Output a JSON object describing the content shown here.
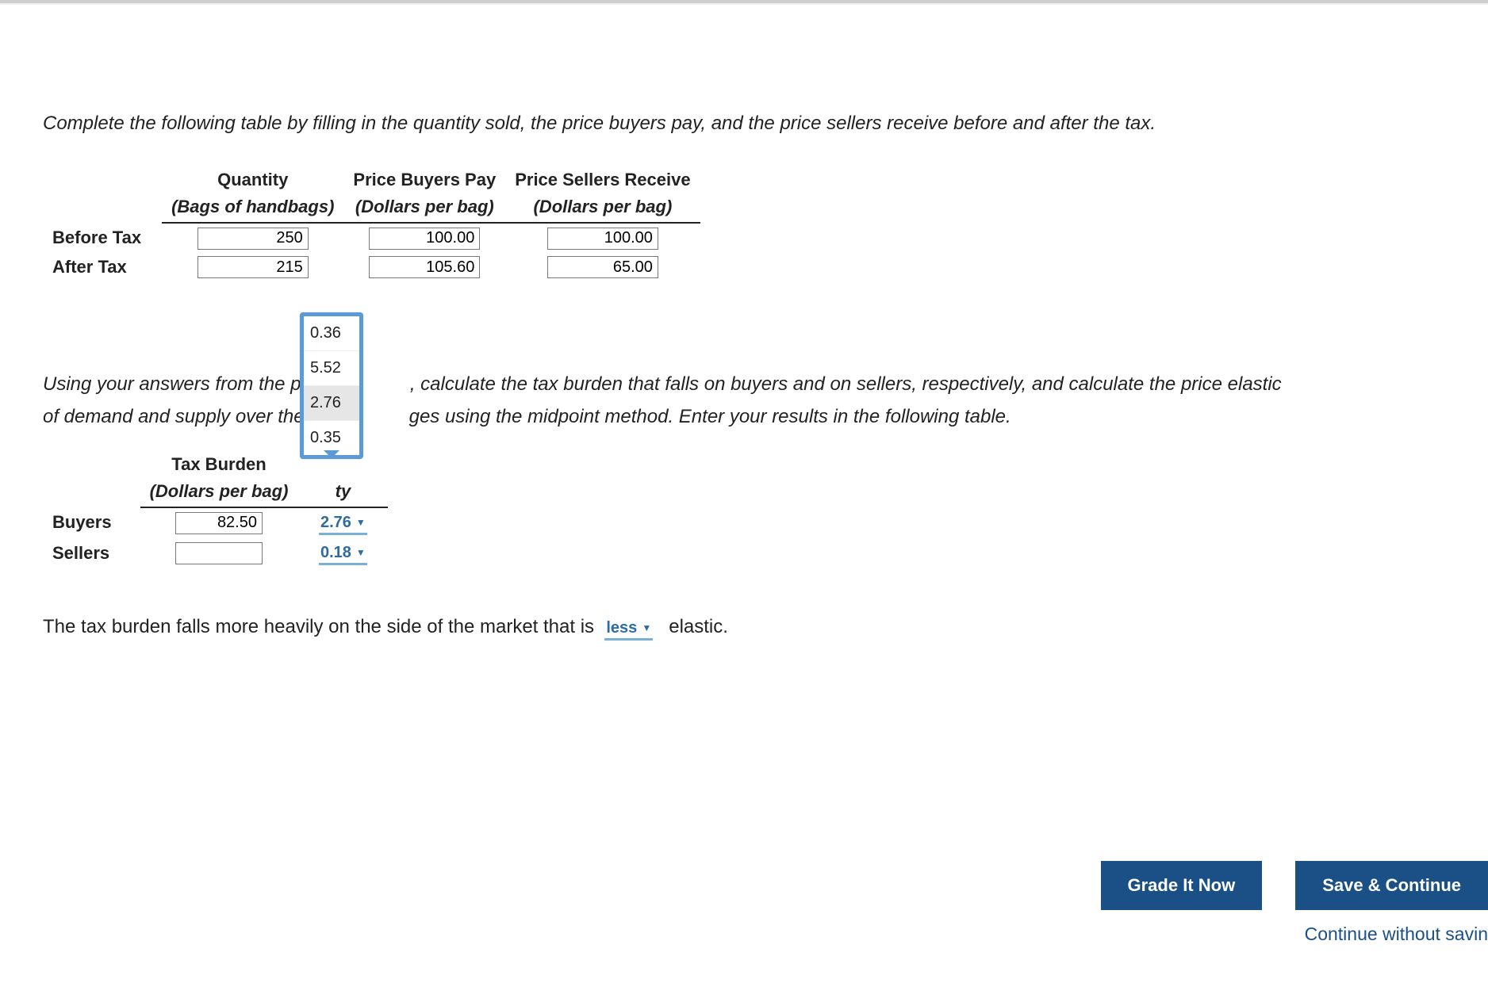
{
  "instruction1": "Complete the following table by filling in the quantity sold, the price buyers pay, and the price sellers receive before and after the tax.",
  "table1": {
    "cols": [
      {
        "head": "Quantity",
        "sub": "(Bags of handbags)"
      },
      {
        "head": "Price Buyers Pay",
        "sub": "(Dollars per bag)"
      },
      {
        "head": "Price Sellers Receive",
        "sub": "(Dollars per bag)"
      }
    ],
    "rows": [
      {
        "label": "Before Tax",
        "v": [
          "250",
          "100.00",
          "100.00"
        ]
      },
      {
        "label": "After Tax",
        "v": [
          "215",
          "105.60",
          "65.00"
        ]
      }
    ]
  },
  "dropdown": {
    "options": [
      "0.36",
      "5.52",
      "2.76",
      "0.35"
    ],
    "selected_index": 2
  },
  "instruction2_a": "Using your answers from the previo",
  "instruction2_b": ", calculate the tax burden that falls on buyers and on sellers, respectively, and calculate the price elastic",
  "instruction2_c": "of demand and supply over the rele",
  "instruction2_d": "ges using the midpoint method. Enter your results in the following table.",
  "table2": {
    "cols": [
      {
        "head": "Tax Burden",
        "sub": "(Dollars per bag)"
      },
      {
        "head_frag": "ty"
      }
    ],
    "rows": [
      {
        "label": "Buyers",
        "burden": "82.50",
        "elasticity": "2.76"
      },
      {
        "label": "Sellers",
        "burden": "",
        "elasticity": "0.18"
      }
    ]
  },
  "final": {
    "pre": "The tax burden falls more heavily on the side of the market that is",
    "choice": "less",
    "post": "elastic."
  },
  "buttons": {
    "grade": "Grade It Now",
    "save": "Save & Continue",
    "continue": "Continue without savin"
  }
}
